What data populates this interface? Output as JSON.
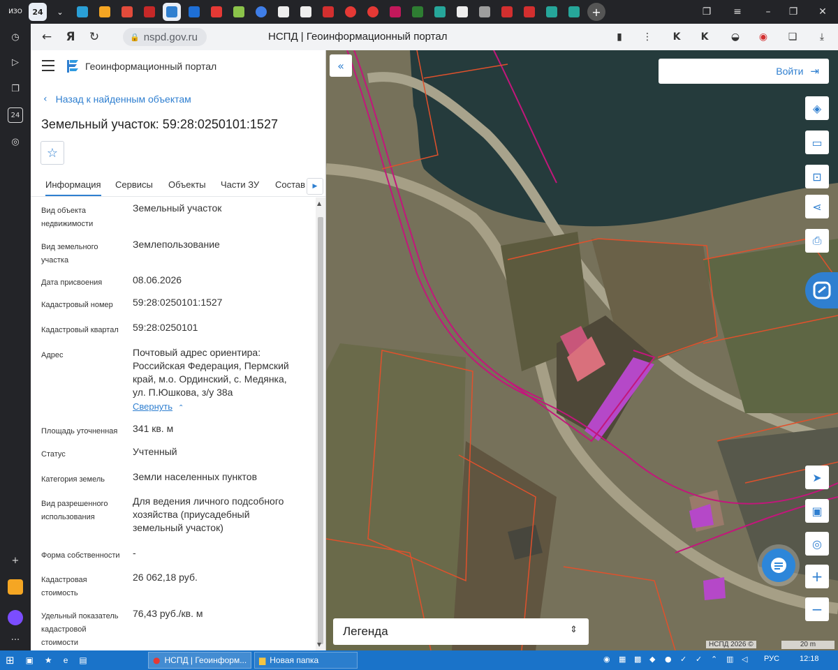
{
  "browser": {
    "tab_labels": [
      "ИЗО",
      "24"
    ],
    "url": "nspd.gov.ru",
    "page_title": "НСПД | Геоинформационный портал"
  },
  "portal": {
    "logo_text": "Геоинформационный портал",
    "back_link": "Назад к найденным объектам",
    "object_title": "Земельный участок: 59:28:0250101:1527",
    "tabs": [
      "Информация",
      "Сервисы",
      "Объекты",
      "Части ЗУ",
      "Состав"
    ],
    "active_tab": "Информация"
  },
  "info": {
    "rows": [
      {
        "label": "Вид объекта недвижимости",
        "value": "Земельный участок"
      },
      {
        "label": "Вид земельного участка",
        "value": "Землепользование"
      },
      {
        "label": "Дата присвоения",
        "value": "08.06.2026"
      },
      {
        "label": "Кадастровый номер",
        "value": "59:28:0250101:1527"
      },
      {
        "label": "Кадастровый квартал",
        "value": "59:28:0250101"
      },
      {
        "label": "Адрес",
        "value": "Почтовый адрес ориентира: Российская Федерация, Пермский край, м.о. Ординский, с. Медянка, ул. П.Юшкова, з/у 38а"
      },
      {
        "label": "Площадь уточненная",
        "value": "341 кв. м"
      },
      {
        "label": "Статус",
        "value": "Учтенный"
      },
      {
        "label": "Категория земель",
        "value": "Земли населенных пунктов"
      },
      {
        "label": "Вид разрешенного использования",
        "value": "Для ведения личного подсобного хозяйства (приусадебный земельный участок)"
      },
      {
        "label": "Форма собственности",
        "value": "-"
      },
      {
        "label": "Кадастровая стоимость",
        "value": "26 062,18 руб."
      },
      {
        "label": "Удельный показатель кадастровой стоимости",
        "value": "76,43 руб./кв. м"
      }
    ],
    "collapse_link": "Свернуть"
  },
  "map": {
    "login_label": "Войти",
    "legend_label": "Легенда",
    "attribution": "НСПД 2026 ©",
    "scale_label": "20 m"
  },
  "taskbar": {
    "apps": [
      "НСПД | Геоинформ...",
      "Новая папка"
    ],
    "language": "РУС",
    "time": "12:18"
  }
}
